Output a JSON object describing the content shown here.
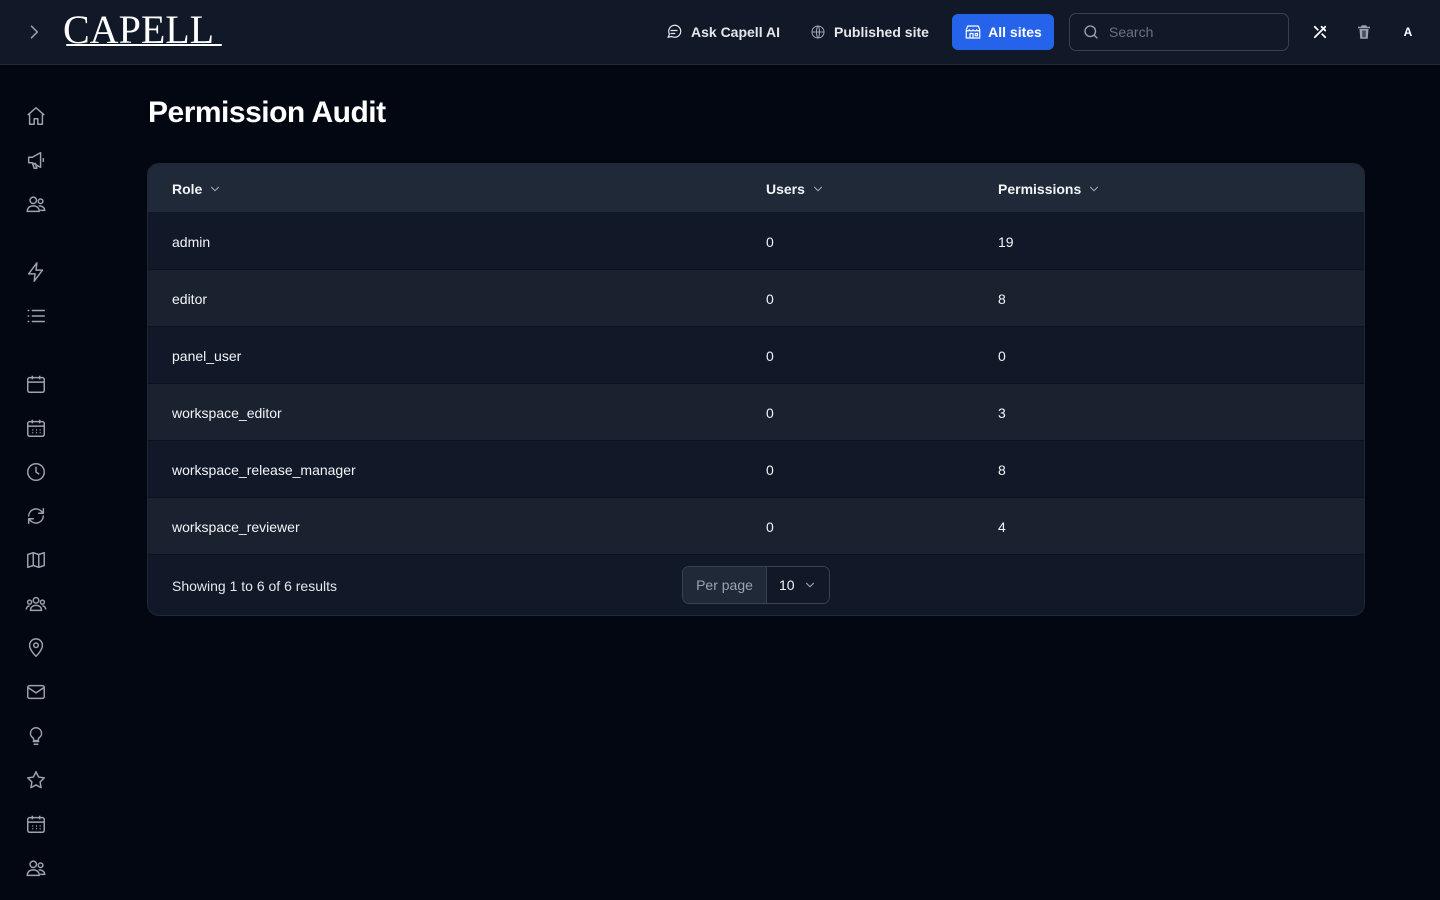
{
  "brand": {
    "logo_text": "CAPELL"
  },
  "topbar": {
    "ask_ai": "Ask Capell AI",
    "published_site": "Published site",
    "all_sites": "All sites",
    "search_placeholder": "Search",
    "avatar_initial": "A"
  },
  "sidebar": {
    "icons": [
      "home-icon",
      "megaphone-icon",
      "users-icon",
      "bolt-icon",
      "list-icon",
      "calendar-icon",
      "calendar-days-icon",
      "clock-icon",
      "refresh-icon",
      "map-icon",
      "user-group-icon",
      "map-pin-icon",
      "envelope-icon",
      "light-bulb-icon",
      "star-icon",
      "calendar-days-icon",
      "users-icon"
    ]
  },
  "page": {
    "title": "Permission Audit"
  },
  "table": {
    "columns": [
      "Role",
      "Users",
      "Permissions"
    ],
    "rows": [
      {
        "role": "admin",
        "users": "0",
        "permissions": "19"
      },
      {
        "role": "editor",
        "users": "0",
        "permissions": "8"
      },
      {
        "role": "panel_user",
        "users": "0",
        "permissions": "0"
      },
      {
        "role": "workspace_editor",
        "users": "0",
        "permissions": "3"
      },
      {
        "role": "workspace_release_manager",
        "users": "0",
        "permissions": "8"
      },
      {
        "role": "workspace_reviewer",
        "users": "0",
        "permissions": "4"
      }
    ],
    "showing_text": "Showing 1 to 6 of 6 results",
    "per_page_label": "Per page",
    "per_page_value": "10"
  },
  "colors": {
    "accent": "#2563eb",
    "background": "#030712",
    "surface": "#111827"
  }
}
